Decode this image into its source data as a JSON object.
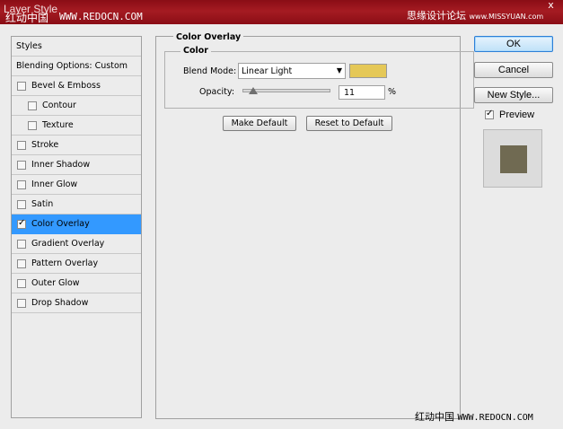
{
  "window": {
    "title": "Layer Style",
    "close_glyph": "x"
  },
  "watermarks": {
    "top_cn": "红动中国",
    "top_url": "WWW.REDOCN.COM",
    "top_right": "思缘设计论坛",
    "top_right_url": "www.MISSYUAN.com",
    "bottom_cn": "红动中国",
    "bottom_url": "WWW.REDOCN.COM"
  },
  "sidebar": {
    "items": [
      {
        "label": "Styles",
        "type": "header"
      },
      {
        "label": "Blending Options: Custom",
        "type": "header"
      },
      {
        "label": "Bevel & Emboss",
        "checked": false
      },
      {
        "label": "Contour",
        "checked": false,
        "sub": true
      },
      {
        "label": "Texture",
        "checked": false,
        "sub": true
      },
      {
        "label": "Stroke",
        "checked": false
      },
      {
        "label": "Inner Shadow",
        "checked": false
      },
      {
        "label": "Inner Glow",
        "checked": false
      },
      {
        "label": "Satin",
        "checked": false
      },
      {
        "label": "Color Overlay",
        "checked": true,
        "selected": true
      },
      {
        "label": "Gradient Overlay",
        "checked": false
      },
      {
        "label": "Pattern Overlay",
        "checked": false
      },
      {
        "label": "Outer Glow",
        "checked": false
      },
      {
        "label": "Drop Shadow",
        "checked": false
      }
    ]
  },
  "main": {
    "group_title": "Color Overlay",
    "subgroup_title": "Color",
    "blend_mode_label": "Blend Mode:",
    "blend_mode_value": "Linear Light",
    "overlay_color": "#e5c857",
    "opacity_label": "Opacity:",
    "opacity_value": "11",
    "opacity_unit": "%",
    "opacity_fraction": 0.11,
    "make_default_label": "Make Default",
    "reset_default_label": "Reset to Default"
  },
  "actions": {
    "ok_label": "OK",
    "cancel_label": "Cancel",
    "new_style_label": "New Style...",
    "preview_label": "Preview",
    "preview_checked": true,
    "preview_color": "#706a52"
  }
}
